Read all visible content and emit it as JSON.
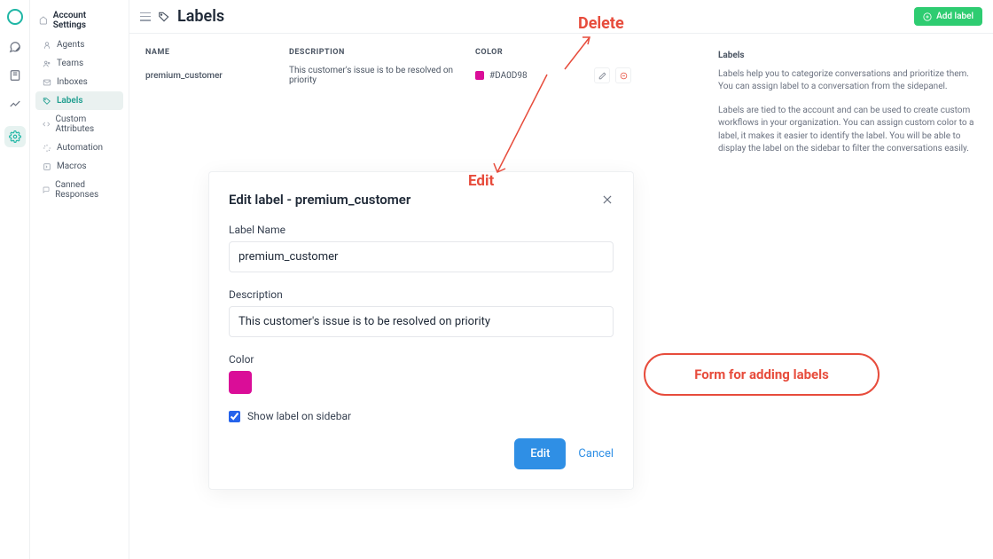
{
  "nav_title": "Account Settings",
  "sidebar": {
    "items": [
      {
        "label": "Agents"
      },
      {
        "label": "Teams"
      },
      {
        "label": "Inboxes"
      },
      {
        "label": "Labels"
      },
      {
        "label": "Custom Attributes"
      },
      {
        "label": "Automation"
      },
      {
        "label": "Macros"
      },
      {
        "label": "Canned Responses"
      }
    ]
  },
  "page": {
    "title": "Labels",
    "add_label": "Add label"
  },
  "table": {
    "head": {
      "name": "NAME",
      "desc": "DESCRIPTION",
      "color": "COLOR"
    },
    "rows": [
      {
        "name": "premium_customer",
        "desc": "This customer's issue is to be resolved on priority",
        "color": "#DA0D98"
      }
    ]
  },
  "info": {
    "title": "Labels",
    "p1": "Labels help you to categorize conversations and prioritize them. You can assign label to a conversation from the sidepanel.",
    "p2": "Labels are tied to the account and can be used to create custom workflows in your organization. You can assign custom color to a label, it makes it easier to identify the label. You will be able to display the label on the sidebar to filter the conversations easily."
  },
  "modal": {
    "title": "Edit label - premium_customer",
    "name_label": "Label Name",
    "name_value": "premium_customer",
    "desc_label": "Description",
    "desc_value": "This customer's issue is to be resolved on priority",
    "color_label": "Color",
    "color_value": "#DA0D98",
    "show_label": "Show label on sidebar",
    "edit": "Edit",
    "cancel": "Cancel"
  },
  "annotations": {
    "delete": "Delete",
    "edit": "Edit",
    "form": "Form for adding labels"
  }
}
